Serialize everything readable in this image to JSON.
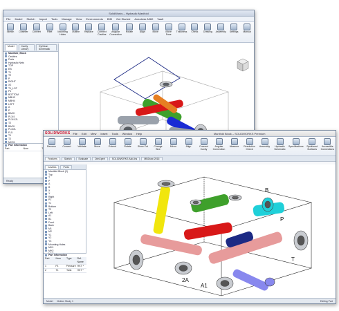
{
  "window1": {
    "title": "SolidWorks – Hydraulic Manifold",
    "menu": [
      "File",
      "Model",
      "Sketch",
      "Import",
      "Tools",
      "Manage",
      "View",
      "Environments",
      "BIM",
      "Get Started",
      "Autodesk A360",
      "Vault"
    ],
    "ribbon": [
      {
        "label": "Sketch"
      },
      {
        "label": "Chamfer"
      },
      {
        "label": "Convert"
      },
      {
        "label": "Fillet"
      },
      {
        "label": "Mounting Holes"
      },
      {
        "label": "Outline"
      },
      {
        "label": "Replace"
      },
      {
        "label": "Connect Cavities"
      },
      {
        "label": "Angular Connection"
      },
      {
        "label": "Rotate"
      },
      {
        "label": "Align"
      },
      {
        "label": "Move"
      },
      {
        "label": "Move Face"
      },
      {
        "label": "Thickness"
      },
      {
        "label": "Check"
      },
      {
        "label": "Drawing"
      },
      {
        "label": "Assembly"
      },
      {
        "label": "Settings"
      },
      {
        "label": "Manual"
      }
    ],
    "tree_title": "Manifold_Block",
    "tree_tabs": [
      "Model",
      "Cavity Library",
      "HyClean Schematic"
    ],
    "tree": [
      "Cavities",
      "Ports",
      "Hydraulic Nets",
      "TOP",
      "EB",
      "T1",
      "T2",
      "P",
      "RIGHT",
      "X2",
      "T1_LOT",
      "P1",
      "BOTTOM",
      "MBH3",
      "MBH4",
      "LEFT",
      "A",
      "P",
      "BACK",
      "PL3/4",
      "PL3/4-2L",
      "T2",
      "BACK",
      "PL3/2L",
      "FL5",
      "T1",
      "T2",
      "MHS1",
      "MHS2",
      "MHS3"
    ],
    "part_info_title": "Part Information",
    "part_info_cols": [
      "Part",
      "Nom",
      "Type"
    ],
    "status": "Ready"
  },
  "window2": {
    "logo": "SOLIDWORKS",
    "title": "Manifold Block – SOLIDWORKS Premium",
    "menu": [
      "File",
      "Edit",
      "View",
      "Insert",
      "Tools",
      "Window",
      "Help"
    ],
    "tabs": [
      "Features",
      "Sketch",
      "Evaluate",
      "DimXpert",
      "SOLIDWORKS Add-Ins",
      "MBDraw 2016"
    ],
    "ribbon": [
      {
        "label": "Remove"
      },
      {
        "label": "Convert"
      },
      {
        "label": "Validate"
      },
      {
        "label": "Move"
      },
      {
        "label": "Extend"
      },
      {
        "label": "Rotate"
      },
      {
        "label": "Show Cut"
      },
      {
        "label": "Change Size"
      },
      {
        "label": "Mirror"
      },
      {
        "label": "Align"
      },
      {
        "label": "Connect Cavity"
      },
      {
        "label": "Angular Connection"
      },
      {
        "label": "Measure"
      },
      {
        "label": "Resolution Check"
      },
      {
        "label": "Assembly"
      },
      {
        "label": "Hydraulic Schematic"
      },
      {
        "label": "Specifications"
      },
      {
        "label": "Spotfaced Surfaces"
      },
      {
        "label": "Accessible Connections"
      }
    ],
    "tree_tabs": [
      "Cavities",
      "Ports"
    ],
    "tree": [
      "Manifold Block (2)",
      "Top",
      "T",
      "P",
      "A",
      "B",
      "X",
      "Y",
      "Right",
      "P1",
      "T1",
      "Bottom",
      "T2",
      "Left",
      "A1",
      "B1",
      "Front",
      "Back",
      "M1",
      "M2",
      "Y1",
      "Y2",
      "Y3",
      "Mounting Holes",
      "MH1",
      "MH2",
      "MH3",
      "MH4"
    ],
    "part_info_title": "Part Information",
    "part_info_cols": [
      "Part",
      "Nom",
      "Type",
      "Ref. Name"
    ],
    "part_info_rows": [
      [
        "1",
        "P1",
        "Pressure",
        "HKT *"
      ],
      [
        "2",
        "T1",
        "Tank",
        "HKT *"
      ]
    ],
    "bottom_tabs": [
      "Model",
      "Motion Study 1"
    ],
    "status": "Editing Part"
  },
  "labels": {
    "a1": "A1",
    "a2": "2A",
    "t": "T",
    "b": "B",
    "p": "P"
  },
  "colors": {
    "green": "#3ea02b",
    "red": "#d81818",
    "blue": "#1a2bd4",
    "orange": "#e67e22",
    "yellow": "#f1e60d",
    "pink": "#e79b9b",
    "cyan": "#1fd0d9",
    "purple": "#8888ee",
    "steel": "#9aa1ab",
    "navy": "#1c2a84"
  }
}
